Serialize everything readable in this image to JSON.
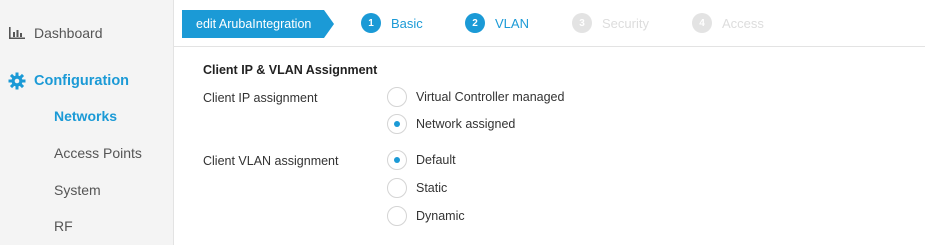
{
  "sidebar": {
    "dashboard": {
      "label": "Dashboard",
      "icon": "bar-chart-icon"
    },
    "configuration": {
      "label": "Configuration",
      "icon": "gear-icon"
    },
    "items": [
      {
        "label": "Networks",
        "active": true
      },
      {
        "label": "Access Points",
        "active": false
      },
      {
        "label": "System",
        "active": false
      },
      {
        "label": "RF",
        "active": false
      }
    ]
  },
  "wizard": {
    "edit_label": "edit ArubaIntegration",
    "steps": [
      {
        "number": "1",
        "label": "Basic",
        "state": "completed"
      },
      {
        "number": "2",
        "label": "VLAN",
        "state": "current"
      },
      {
        "number": "3",
        "label": "Security",
        "state": "pending"
      },
      {
        "number": "4",
        "label": "Access",
        "state": "pending"
      }
    ]
  },
  "form": {
    "section_title": "Client IP & VLAN Assignment",
    "ip_assignment": {
      "label": "Client IP assignment",
      "options": [
        "Virtual Controller managed",
        "Network assigned"
      ],
      "selected": "Network assigned"
    },
    "vlan_assignment": {
      "label": "Client VLAN assignment",
      "options": [
        "Default",
        "Static",
        "Dynamic"
      ],
      "selected": "Default"
    }
  },
  "colors": {
    "accent": "#1b9ad6",
    "sidebar_bg": "#f4f4f4",
    "disabled": "#e3e3e3"
  }
}
